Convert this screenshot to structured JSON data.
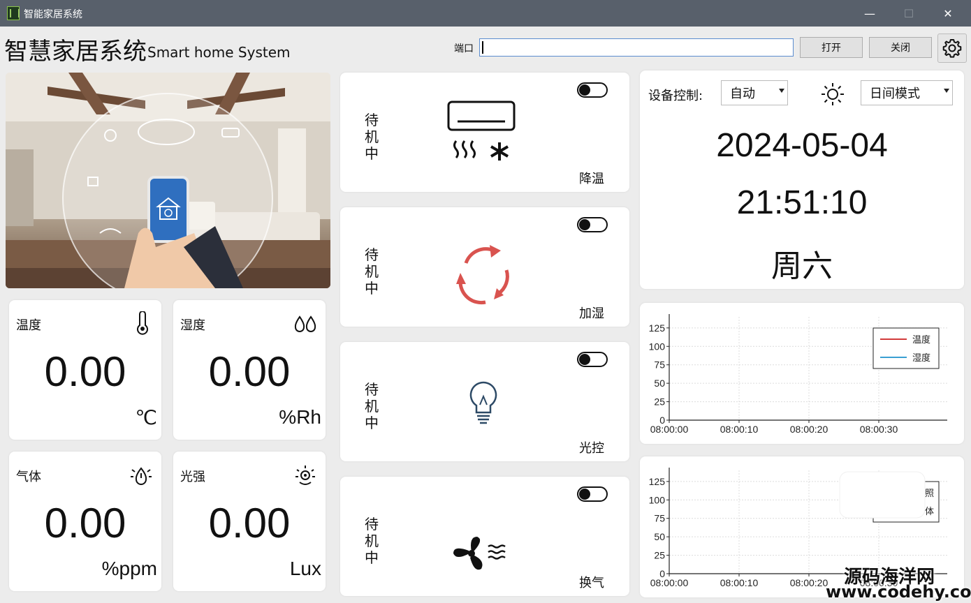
{
  "window": {
    "title": "智能家居系统",
    "min": "—",
    "max": "☐",
    "close": "✕"
  },
  "header": {
    "title": "智慧家居系统",
    "subtitle": "Smart home System"
  },
  "port": {
    "label": "端口",
    "value": "",
    "open_label": "打开",
    "close_label": "关闭"
  },
  "sensors": [
    {
      "label": "温度",
      "value": "0.00",
      "unit": "℃",
      "icon": "thermometer-icon"
    },
    {
      "label": "湿度",
      "value": "0.00",
      "unit": "%Rh",
      "icon": "water-drops-icon"
    },
    {
      "label": "气体",
      "value": "0.00",
      "unit": "%ppm",
      "icon": "gas-drop-icon"
    },
    {
      "label": "光强",
      "value": "0.00",
      "unit": "Lux",
      "icon": "sun-icon"
    }
  ],
  "devices": [
    {
      "status_chars": [
        "待",
        "机",
        "中"
      ],
      "name": "降温",
      "icon": "air-conditioner-icon"
    },
    {
      "status_chars": [
        "待",
        "机",
        "中"
      ],
      "name": "加湿",
      "icon": "recycle-arrows-icon"
    },
    {
      "status_chars": [
        "待",
        "机",
        "中"
      ],
      "name": "光控",
      "icon": "light-bulb-icon"
    },
    {
      "status_chars": [
        "待",
        "机",
        "中"
      ],
      "name": "换气",
      "icon": "fan-icon"
    }
  ],
  "control": {
    "label": "设备控制:",
    "mode": "自动",
    "day_mode": "日间模式",
    "date": "2024-05-04",
    "time": "21:51:10",
    "weekday": "周六"
  },
  "chart_data": [
    {
      "type": "line",
      "x": [
        "08:00:00",
        "08:00:10",
        "08:00:20",
        "08:00:30"
      ],
      "yticks": [
        0,
        25,
        50,
        75,
        100,
        125
      ],
      "ylim": [
        0,
        140
      ],
      "grid": true,
      "legend": "top-right",
      "series": [
        {
          "name": "温度",
          "color": "#d23a3a",
          "values": []
        },
        {
          "name": "湿度",
          "color": "#3a9fd2",
          "values": []
        }
      ]
    },
    {
      "type": "line",
      "x": [
        "08:00:00",
        "08:00:10",
        "08:00:20",
        "08:00:30"
      ],
      "yticks": [
        0,
        25,
        50,
        75,
        100,
        125
      ],
      "ylim": [
        0,
        140
      ],
      "grid": true,
      "legend": "top-right",
      "legend_visible_text": [
        "照",
        "体"
      ],
      "series": []
    }
  ],
  "watermark": {
    "line1": "源码海洋网",
    "line2": "www.codehy.com"
  },
  "colors": {
    "titlebar": "#58606b",
    "background": "#ececec",
    "card": "#ffffff",
    "red_arrow": "#d9534f",
    "input_border": "#5b8ccf"
  }
}
